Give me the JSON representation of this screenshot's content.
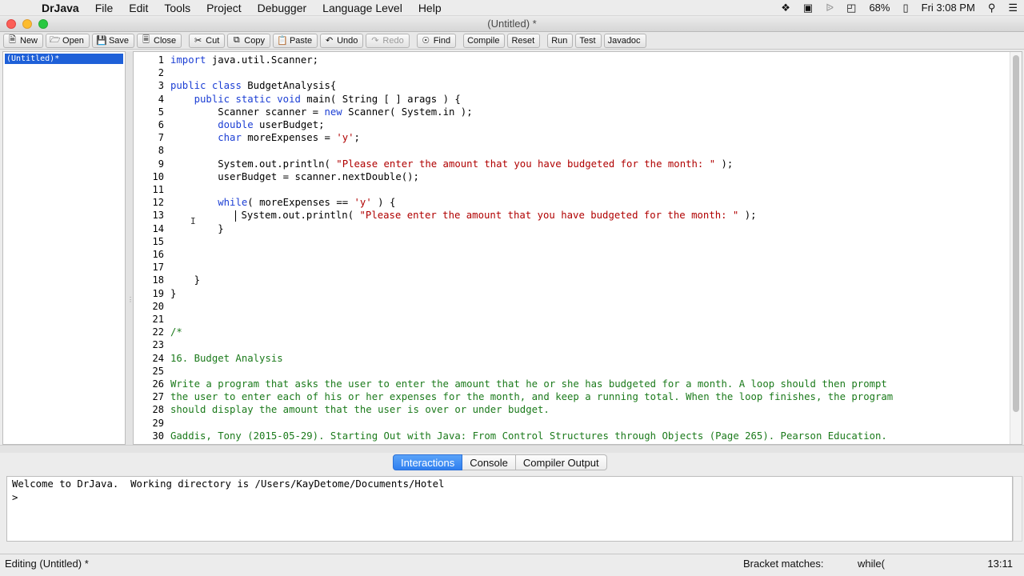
{
  "menubar": {
    "app_name": "DrJava",
    "items": [
      "File",
      "Edit",
      "Tools",
      "Project",
      "Debugger",
      "Language Level",
      "Help"
    ],
    "battery": "68%",
    "clock": "Fri 3:08 PM"
  },
  "window": {
    "title": "(Untitled) *"
  },
  "toolbar": {
    "new": "New",
    "open": "Open",
    "save": "Save",
    "close": "Close",
    "cut": "Cut",
    "copy": "Copy",
    "paste": "Paste",
    "undo": "Undo",
    "redo": "Redo",
    "find": "Find",
    "compile": "Compile",
    "reset": "Reset",
    "run": "Run",
    "test": "Test",
    "javadoc": "Javadoc"
  },
  "documents": [
    "(Untitled)*"
  ],
  "editor": {
    "line_numbers": [
      "1",
      "2",
      "3",
      "4",
      "5",
      "6",
      "7",
      "8",
      "9",
      "10",
      "11",
      "12",
      "13",
      "14",
      "15",
      "16",
      "17",
      "18",
      "19",
      "20",
      "21",
      "22",
      "23",
      "24",
      "25",
      "26",
      "27",
      "28",
      "29",
      "30"
    ],
    "lines": [
      "import java.util.Scanner;",
      "",
      "public class BudgetAnalysis{",
      "    public static void main( String [ ] arags ) {",
      "        Scanner scanner = new Scanner( System.in );",
      "        double userBudget;",
      "        char moreExpenses = 'y';",
      "",
      "        System.out.println( \"Please enter the amount that you have budgeted for the month: \" );",
      "        userBudget = scanner.nextDouble();",
      "",
      "        while( moreExpenses == 'y' ) {",
      "            System.out.println( \"Please enter the amount that you have budgeted for the month: \" );",
      "        }",
      "",
      "",
      "",
      "    }",
      "}",
      "",
      "",
      "/*",
      "",
      "16. Budget Analysis",
      "",
      "Write a program that asks the user to enter the amount that he or she has budgeted for a month. A loop should then prompt",
      "the user to enter each of his or her expenses for the month, and keep a running total. When the loop finishes, the program",
      "should display the amount that the user is over or under budget.",
      "",
      "Gaddis, Tony (2015-05-29). Starting Out with Java: From Control Structures through Objects (Page 265). Pearson Education."
    ]
  },
  "tabs": [
    "Interactions",
    "Console",
    "Compiler Output"
  ],
  "interactions": {
    "welcome": "Welcome to DrJava.  Working directory is /Users/KayDetome/Documents/Hotel",
    "prompt": ">"
  },
  "status": {
    "editing": "Editing (Untitled) *",
    "bracket_label": "Bracket matches:",
    "bracket_value": "while(",
    "position": "13:11"
  },
  "colors": {
    "keyword": "#1b3ed4",
    "string": "#b00000",
    "comment": "#1b7a1b",
    "selection": "#1e60d8",
    "active_tab": "#2f7ff0"
  },
  "icons": [
    "apple-icon",
    "dropbox-icon",
    "camera-icon",
    "bluetooth-icon",
    "wifi-icon",
    "battery-icon",
    "search-icon",
    "menu-list-icon"
  ]
}
